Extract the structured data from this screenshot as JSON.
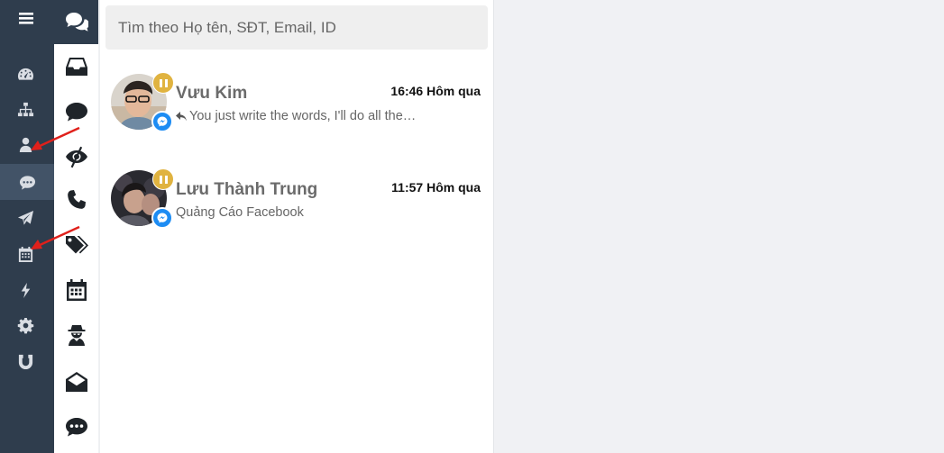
{
  "rail": {
    "items": [
      {
        "icon": "menu-icon"
      },
      {
        "icon": "dashboard-icon"
      },
      {
        "icon": "sitemap-icon"
      },
      {
        "icon": "user-icon"
      },
      {
        "icon": "chat-icon",
        "active": true
      },
      {
        "icon": "paper-plane-icon"
      },
      {
        "icon": "calendar-icon"
      },
      {
        "icon": "lightning-icon"
      },
      {
        "icon": "gear-icon"
      },
      {
        "icon": "magnet-icon"
      }
    ],
    "accent_color": "#2fc5ef",
    "background_color": "#2f3d4d"
  },
  "subnav": {
    "items": [
      {
        "icon": "comments-icon"
      },
      {
        "icon": "inbox-icon"
      },
      {
        "icon": "comment-icon"
      },
      {
        "icon": "eye-slash-icon"
      },
      {
        "icon": "phone-icon"
      },
      {
        "icon": "tags-icon"
      },
      {
        "icon": "calendar-icon"
      },
      {
        "icon": "spy-icon"
      },
      {
        "icon": "envelope-open-icon"
      },
      {
        "icon": "comment-dots-icon"
      }
    ]
  },
  "search": {
    "placeholder": "Tìm theo Họ tên, SĐT, Email, ID",
    "value": ""
  },
  "conversations": [
    {
      "name": "Vưu Kim",
      "time": "16:46 Hôm qua",
      "preview": "You just write the words, I'll do all the…",
      "replied": true,
      "channel": "messenger-icon",
      "status": "paused"
    },
    {
      "name": "Lưu Thành Trung",
      "time": "11:57 Hôm qua",
      "preview": "Quảng Cáo Facebook",
      "replied": false,
      "channel": "messenger-icon",
      "status": "paused"
    }
  ]
}
